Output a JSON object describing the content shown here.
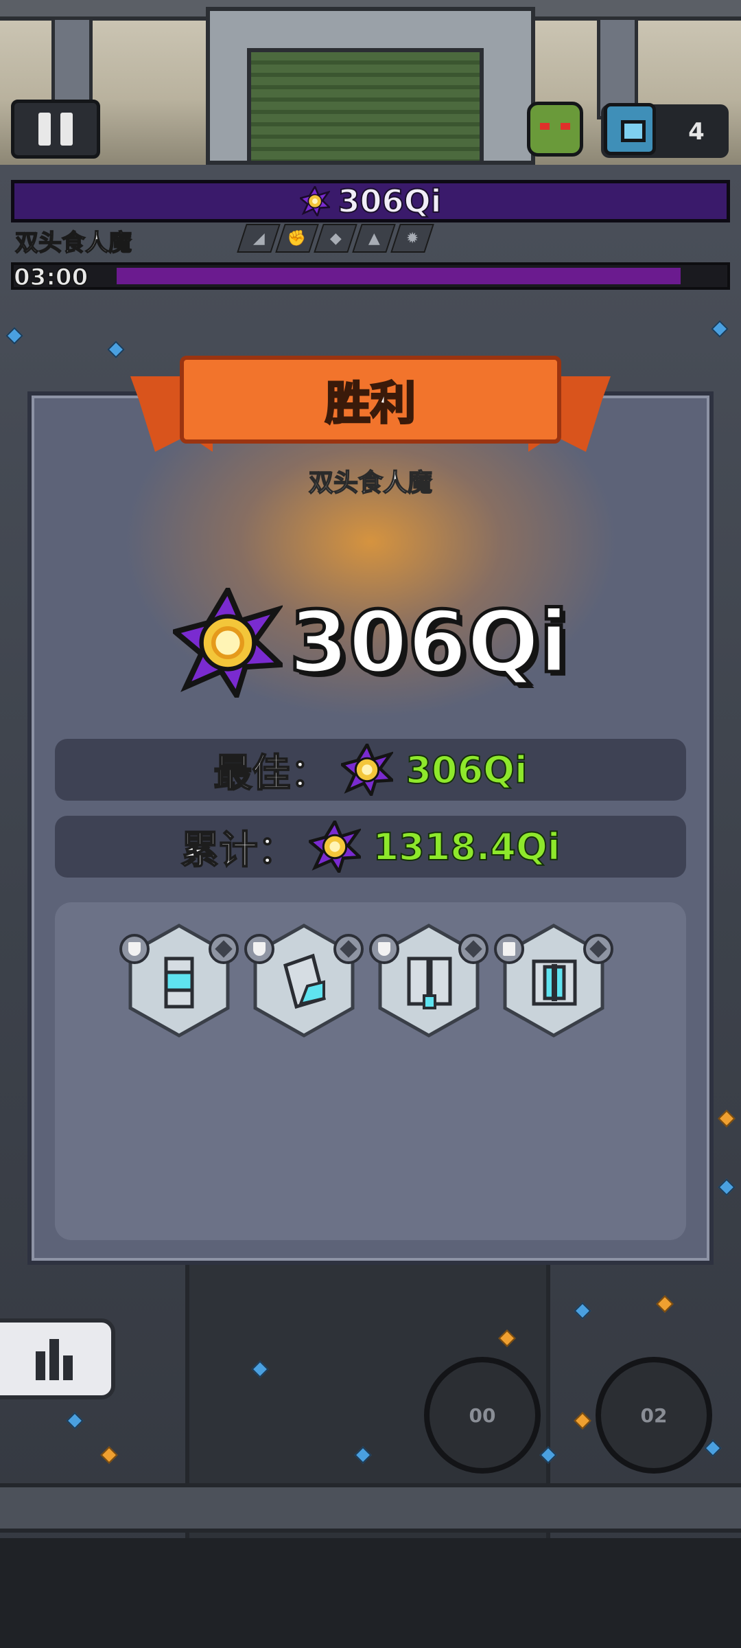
{
  "hud": {
    "chest_count": "4",
    "boss_hp": "306Qi",
    "boss_name": "双头食人魔",
    "timer": "03:00",
    "timer_progress": 0.93
  },
  "victory": {
    "title": "胜利",
    "boss_name": "双头食人魔",
    "damage": "306Qi",
    "best_label": "最佳：",
    "best_value": "306Qi",
    "total_label": "累计：",
    "total_value": "1318.4Qi",
    "equipment": [
      {
        "name": "cylinder",
        "left_badge": "shield-icon",
        "right_badge": "skull-icon"
      },
      {
        "name": "crystal-shard",
        "left_badge": "shield-icon",
        "right_badge": "feather-icon"
      },
      {
        "name": "twin-tanks",
        "left_badge": "shield-icon",
        "right_badge": "plate-icon"
      },
      {
        "name": "magnet-block",
        "left_badge": "crown-icon",
        "right_badge": "beast-icon"
      }
    ]
  },
  "controls": {
    "skill_1": "00",
    "skill_2": "02"
  },
  "colors": {
    "accent_green": "#8ee82c",
    "ribbon_orange": "#f2742c",
    "hp_purple": "#3a1a6b"
  }
}
